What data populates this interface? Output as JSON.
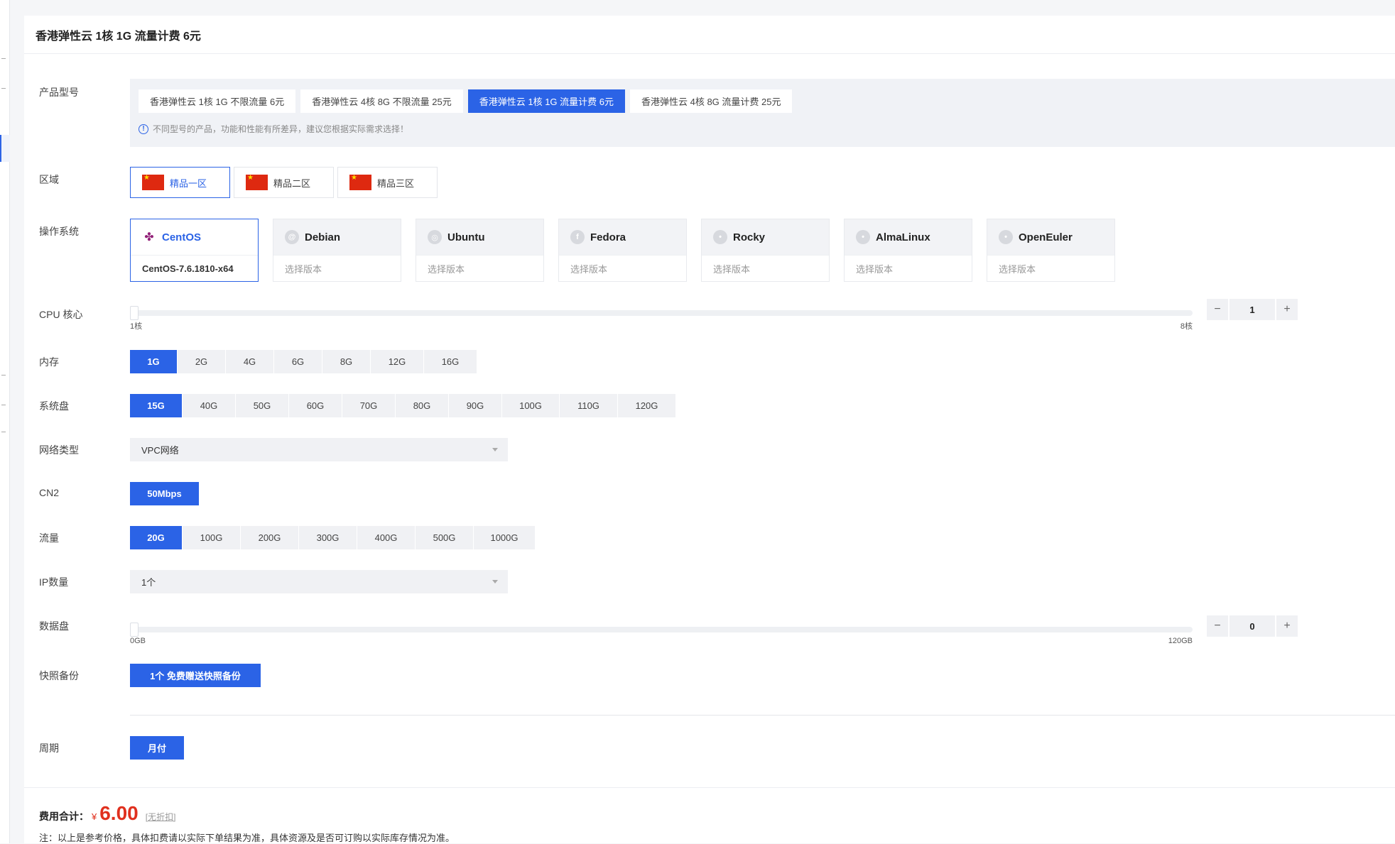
{
  "header": {
    "title": "香港弹性云 1核 1G 流量计费 6元"
  },
  "model": {
    "label": "产品型号",
    "options": [
      "香港弹性云 1核 1G 不限流量 6元",
      "香港弹性云 4核 8G 不限流量 25元",
      "香港弹性云 1核 1G 流量计费 6元",
      "香港弹性云 4核 8G 流量计费 25元"
    ],
    "selected_index": 2,
    "tip": "不同型号的产品，功能和性能有所差异，建议您根据实际需求选择！"
  },
  "region": {
    "label": "区域",
    "options": [
      "精品一区",
      "精品二区",
      "精品三区"
    ],
    "selected_index": 0
  },
  "os": {
    "label": "操作系统",
    "items": [
      {
        "name": "CentOS",
        "version": "CentOS-7.6.1810-x64",
        "icon": "centos-icon"
      },
      {
        "name": "Debian",
        "version": "选择版本",
        "icon": "debian-icon"
      },
      {
        "name": "Ubuntu",
        "version": "选择版本",
        "icon": "ubuntu-icon"
      },
      {
        "name": "Fedora",
        "version": "选择版本",
        "icon": "fedora-icon"
      },
      {
        "name": "Rocky",
        "version": "选择版本",
        "icon": "rocky-icon"
      },
      {
        "name": "AlmaLinux",
        "version": "选择版本",
        "icon": "almalinux-icon"
      },
      {
        "name": "OpenEuler",
        "version": "选择版本",
        "icon": "openeuler-icon"
      }
    ],
    "selected_index": 0
  },
  "cpu": {
    "label": "CPU 核心",
    "min": "1核",
    "max": "8核",
    "value": "1",
    "minus": "−",
    "plus": "+"
  },
  "memory": {
    "label": "内存",
    "options": [
      "1G",
      "2G",
      "4G",
      "6G",
      "8G",
      "12G",
      "16G"
    ],
    "selected_index": 0
  },
  "disk": {
    "label": "系统盘",
    "options": [
      "15G",
      "40G",
      "50G",
      "60G",
      "70G",
      "80G",
      "90G",
      "100G",
      "110G",
      "120G"
    ],
    "selected_index": 0
  },
  "network": {
    "label": "网络类型",
    "value": "VPC网络"
  },
  "cn2": {
    "label": "CN2",
    "value": "50Mbps"
  },
  "traffic": {
    "label": "流量",
    "options": [
      "20G",
      "100G",
      "200G",
      "300G",
      "400G",
      "500G",
      "1000G"
    ],
    "selected_index": 0
  },
  "ip": {
    "label": "IP数量",
    "value": "1个"
  },
  "data_disk": {
    "label": "数据盘",
    "min": "0GB",
    "max": "120GB",
    "value": "0",
    "minus": "−",
    "plus": "+"
  },
  "snapshot": {
    "label": "快照备份",
    "value": "1个 免费赠送快照备份"
  },
  "period": {
    "label": "周期",
    "value": "月付"
  },
  "total": {
    "label": "费用合计：",
    "currency": "¥",
    "price": "6.00",
    "discount": "[无折扣]"
  },
  "note": "注：以上是参考价格，具体扣费请以实际下单结果为准，具体资源及是否可订购以实际库存情况为准。",
  "colors": {
    "accent": "#2b63e6",
    "price": "#e0301e"
  }
}
